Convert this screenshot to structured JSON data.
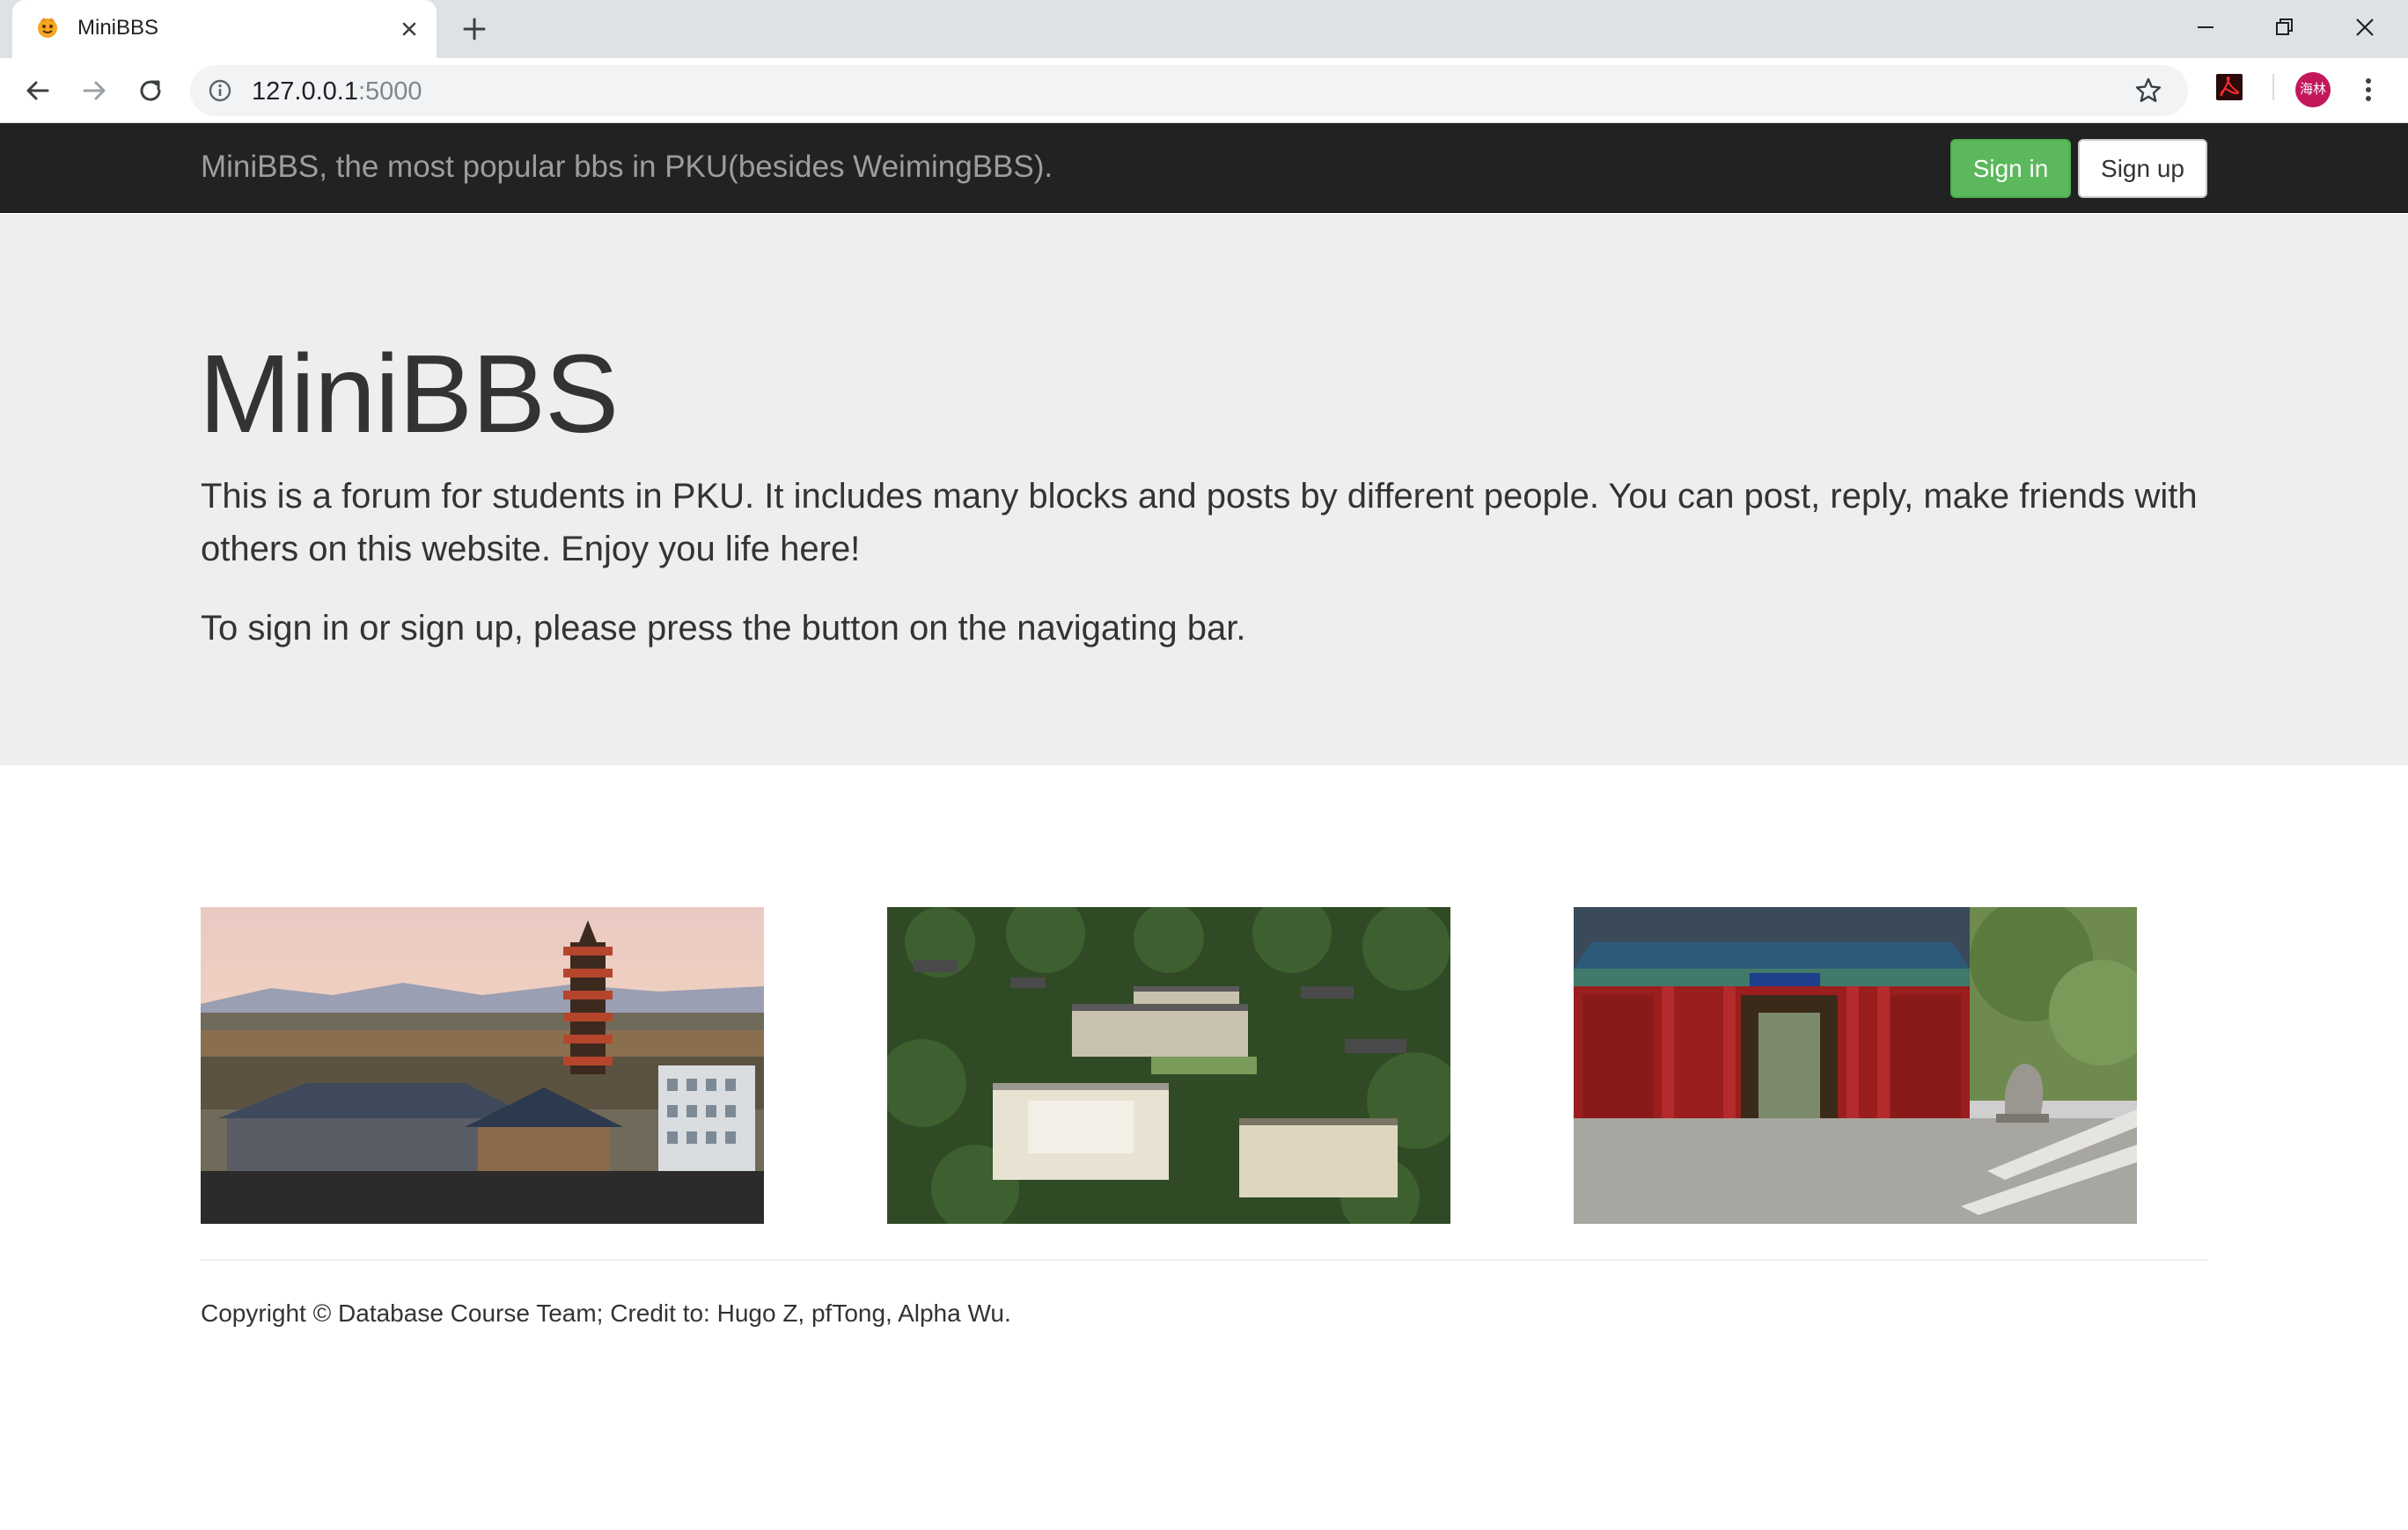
{
  "browser": {
    "tab_title": "MiniBBS",
    "url_host": "127.0.0.1",
    "url_port": ":5000",
    "profile_initials": "海林"
  },
  "navbar": {
    "brand": "MiniBBS, the most popular bbs in PKU(besides WeimingBBS).",
    "signin_label": "Sign in",
    "signup_label": "Sign up",
    "signin_color": "#5cb85c"
  },
  "jumbotron": {
    "title": "MiniBBS",
    "paragraph1": "This is a forum for students in PKU. It includes many blocks and posts by different people. You can post, reply, make friends with others on this website. Enjoy you life here!",
    "paragraph2": "To sign in or sign up, please press the button on the navigating bar."
  },
  "photos": [
    {
      "subject": "pagoda-at-sunset"
    },
    {
      "subject": "campus-aerial-view"
    },
    {
      "subject": "red-campus-gate"
    }
  ],
  "footer": {
    "text": "Copyright © Database Course Team; Credit to: Hugo Z, pfTong, Alpha Wu."
  }
}
